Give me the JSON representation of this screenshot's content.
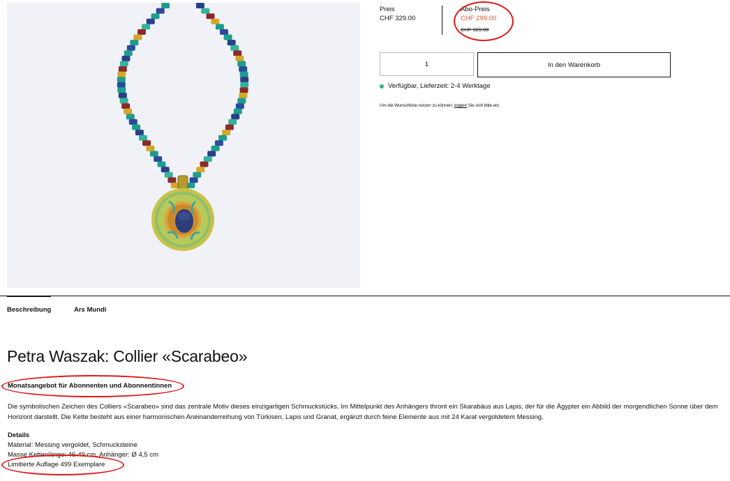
{
  "price": {
    "label": "Preis",
    "value": "CHF 329.00",
    "abo_label": "Abo-Preis",
    "abo_value": "CHF 299.00",
    "abo_strike": "CHF 329.00"
  },
  "cart": {
    "quantity": "1",
    "button_label": "In den Warenkorb"
  },
  "availability": "Verfügbar, Lieferzeit: 2-4 Werktage",
  "wishlist": {
    "prefix": "Um die Wunschliste nutzen zu können,",
    "link": "loggen",
    "suffix": "Sie sich bitte ein."
  },
  "tabs": [
    "Beschreibung",
    "Ars Mundi"
  ],
  "product": {
    "title": "Petra Waszak: Collier «Scarabeo»",
    "offer": "Monatsangebot für Abonnenten und Abonnentinnen",
    "description": "Die symbolischen Zeichen des Colliers «Scarabeo» sind das zentrale Motiv dieses einzigartigen Schmuckstücks. Im Mittelpunkt des Anhängers thront ein Skarabäus aus Lapis, der für die Ägypter ein Abbild der morgendlichen Sonne über dem Horizont darstellt. Die Kette besteht aus einer harmonischen Aneinanderreihung von Türkisen, Lapis und Granat, ergänzt durch feine Elemente aus mit 24 Karat vergoldetem Messing.",
    "details_title": "Details",
    "details": [
      "Material: Messing vergoldet, Schmucksteine",
      "Masse Kettenlänge: 46-49 cm, Anhänger: Ø 4,5 cm",
      "Limitierte Auflage 499 Exemplare"
    ]
  },
  "colors": {
    "accent_price": "#d9532f",
    "annotation_red": "#e01919",
    "available_green": "#2bb673",
    "image_bg": "#f1f2f7"
  }
}
